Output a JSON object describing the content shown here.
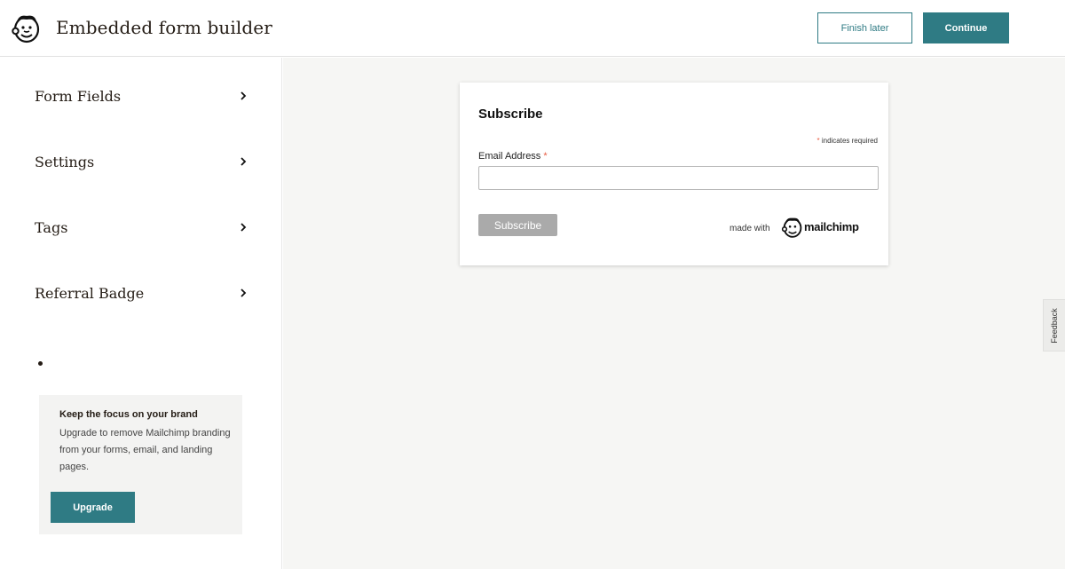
{
  "header": {
    "title": "Embedded form builder",
    "finish_later_label": "Finish later",
    "continue_label": "Continue",
    "logo_icon": "mailchimp-freddie-icon"
  },
  "sidebar": {
    "items": [
      {
        "label": "Form Fields",
        "icon": "chevron-right-icon"
      },
      {
        "label": "Settings",
        "icon": "chevron-right-icon"
      },
      {
        "label": "Tags",
        "icon": "chevron-right-icon"
      },
      {
        "label": "Referral Badge",
        "icon": "chevron-right-icon"
      }
    ],
    "promo": {
      "title": "Keep the focus on your brand",
      "text": "Upgrade to remove Mailchimp branding from your forms, email, and landing pages.",
      "button_label": "Upgrade"
    }
  },
  "form": {
    "heading": "Subscribe",
    "required_asterisk": "*",
    "required_note": "indicates required",
    "email_label": "Email Address",
    "email_value": "",
    "subscribe_label": "Subscribe",
    "made_with": "made with",
    "brand_word": "mailchimp"
  },
  "feedback_label": "Feedback",
  "colors": {
    "accent": "#2f7b84",
    "required": "#e85c41",
    "canvas_bg": "#f6f6f4",
    "disabled_button": "#aaaaaa"
  }
}
